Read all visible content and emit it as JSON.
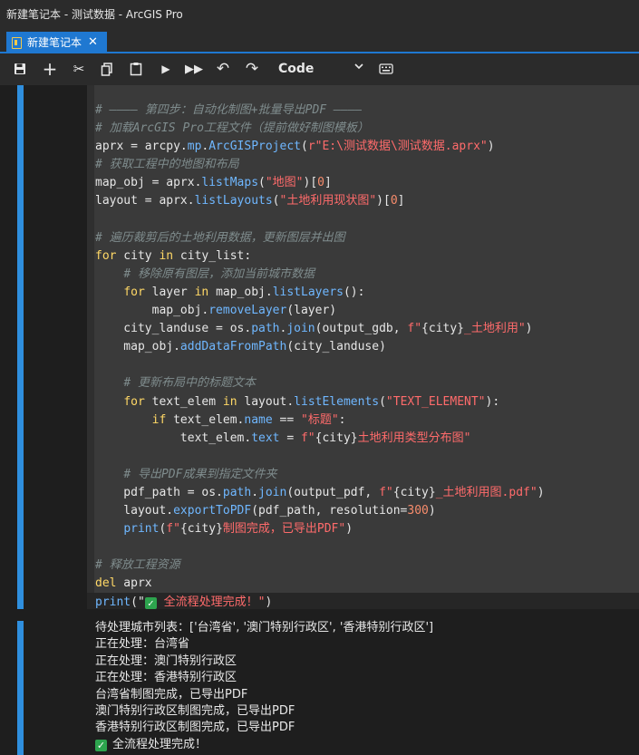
{
  "window": {
    "title": "新建笔记本 - 测试数据 - ArcGIS Pro"
  },
  "tab": {
    "label": "新建笔记本",
    "close": "✕"
  },
  "toolbar": {
    "buttons": [
      {
        "name": "save-icon",
        "glyph": "💾"
      },
      {
        "name": "add-cell-icon",
        "glyph": "+"
      },
      {
        "name": "cut-icon",
        "glyph": "✂"
      },
      {
        "name": "copy-icon",
        "glyph": "⧉"
      },
      {
        "name": "paste-icon",
        "glyph": "📋"
      },
      {
        "name": "run-icon",
        "glyph": "▶"
      },
      {
        "name": "run-all-icon",
        "glyph": "⏩"
      },
      {
        "name": "undo-icon",
        "glyph": "↶"
      },
      {
        "name": "redo-icon",
        "glyph": "↷"
      }
    ],
    "cell_type": "Code",
    "keyboard_icon": "⌨"
  },
  "code_lines": [
    [
      {
        "t": "c",
        "v": "# ———— 第四步：自动化制图+批量导出PDF ————"
      }
    ],
    [
      {
        "t": "c",
        "v": "# 加载ArcGIS Pro工程文件（提前做好制图模板）"
      }
    ],
    [
      {
        "t": "n",
        "v": "aprx = arcpy."
      },
      {
        "t": "f",
        "v": "mp"
      },
      {
        "t": "n",
        "v": "."
      },
      {
        "t": "f",
        "v": "ArcGISProject"
      },
      {
        "t": "n",
        "v": "("
      },
      {
        "t": "s",
        "v": "r\"E:\\测试数据\\测试数据.aprx\""
      },
      {
        "t": "n",
        "v": ")"
      }
    ],
    [
      {
        "t": "c",
        "v": "# 获取工程中的地图和布局"
      }
    ],
    [
      {
        "t": "n",
        "v": "map_obj = aprx."
      },
      {
        "t": "f",
        "v": "listMaps"
      },
      {
        "t": "n",
        "v": "("
      },
      {
        "t": "s",
        "v": "\"地图\""
      },
      {
        "t": "n",
        "v": ")["
      },
      {
        "t": "num",
        "v": "0"
      },
      {
        "t": "n",
        "v": "]"
      }
    ],
    [
      {
        "t": "n",
        "v": "layout = aprx."
      },
      {
        "t": "f",
        "v": "listLayouts"
      },
      {
        "t": "n",
        "v": "("
      },
      {
        "t": "s",
        "v": "\"土地利用现状图\""
      },
      {
        "t": "n",
        "v": ")["
      },
      {
        "t": "num",
        "v": "0"
      },
      {
        "t": "n",
        "v": "]"
      }
    ],
    [],
    [
      {
        "t": "c",
        "v": "# 遍历裁剪后的土地利用数据，更新图层并出图"
      }
    ],
    [
      {
        "t": "k",
        "v": "for"
      },
      {
        "t": "n",
        "v": " city "
      },
      {
        "t": "k",
        "v": "in"
      },
      {
        "t": "n",
        "v": " city_list:"
      }
    ],
    [
      {
        "t": "n",
        "v": "    "
      },
      {
        "t": "c",
        "v": "# 移除原有图层，添加当前城市数据"
      }
    ],
    [
      {
        "t": "n",
        "v": "    "
      },
      {
        "t": "k",
        "v": "for"
      },
      {
        "t": "n",
        "v": " layer "
      },
      {
        "t": "k",
        "v": "in"
      },
      {
        "t": "n",
        "v": " map_obj."
      },
      {
        "t": "f",
        "v": "listLayers"
      },
      {
        "t": "n",
        "v": "():"
      }
    ],
    [
      {
        "t": "n",
        "v": "        map_obj."
      },
      {
        "t": "f",
        "v": "removeLayer"
      },
      {
        "t": "n",
        "v": "(layer)"
      }
    ],
    [
      {
        "t": "n",
        "v": "    city_landuse = os."
      },
      {
        "t": "f",
        "v": "path"
      },
      {
        "t": "n",
        "v": "."
      },
      {
        "t": "f",
        "v": "join"
      },
      {
        "t": "n",
        "v": "(output_gdb, "
      },
      {
        "t": "s",
        "v": "f\""
      },
      {
        "t": "n",
        "v": "{city}"
      },
      {
        "t": "s",
        "v": "_土地利用\""
      },
      {
        "t": "n",
        "v": ")"
      }
    ],
    [
      {
        "t": "n",
        "v": "    map_obj."
      },
      {
        "t": "f",
        "v": "addDataFromPath"
      },
      {
        "t": "n",
        "v": "(city_landuse)"
      }
    ],
    [],
    [
      {
        "t": "n",
        "v": "    "
      },
      {
        "t": "c",
        "v": "# 更新布局中的标题文本"
      }
    ],
    [
      {
        "t": "n",
        "v": "    "
      },
      {
        "t": "k",
        "v": "for"
      },
      {
        "t": "n",
        "v": " text_elem "
      },
      {
        "t": "k",
        "v": "in"
      },
      {
        "t": "n",
        "v": " layout."
      },
      {
        "t": "f",
        "v": "listElements"
      },
      {
        "t": "n",
        "v": "("
      },
      {
        "t": "s",
        "v": "\"TEXT_ELEMENT\""
      },
      {
        "t": "n",
        "v": "):"
      }
    ],
    [
      {
        "t": "n",
        "v": "        "
      },
      {
        "t": "k",
        "v": "if"
      },
      {
        "t": "n",
        "v": " text_elem."
      },
      {
        "t": "f",
        "v": "name"
      },
      {
        "t": "n",
        "v": " == "
      },
      {
        "t": "s",
        "v": "\"标题\""
      },
      {
        "t": "n",
        "v": ":"
      }
    ],
    [
      {
        "t": "n",
        "v": "            text_elem."
      },
      {
        "t": "f",
        "v": "text"
      },
      {
        "t": "n",
        "v": " = "
      },
      {
        "t": "s",
        "v": "f\""
      },
      {
        "t": "n",
        "v": "{city}"
      },
      {
        "t": "s",
        "v": "土地利用类型分布图\""
      }
    ],
    [],
    [
      {
        "t": "n",
        "v": "    "
      },
      {
        "t": "c",
        "v": "# 导出PDF成果到指定文件夹"
      }
    ],
    [
      {
        "t": "n",
        "v": "    pdf_path = os."
      },
      {
        "t": "f",
        "v": "path"
      },
      {
        "t": "n",
        "v": "."
      },
      {
        "t": "f",
        "v": "join"
      },
      {
        "t": "n",
        "v": "(output_pdf, "
      },
      {
        "t": "s",
        "v": "f\""
      },
      {
        "t": "n",
        "v": "{city}"
      },
      {
        "t": "s",
        "v": "_土地利用图.pdf\""
      },
      {
        "t": "n",
        "v": ")"
      }
    ],
    [
      {
        "t": "n",
        "v": "    layout."
      },
      {
        "t": "f",
        "v": "exportToPDF"
      },
      {
        "t": "n",
        "v": "(pdf_path, resolution="
      },
      {
        "t": "num",
        "v": "300"
      },
      {
        "t": "n",
        "v": ")"
      }
    ],
    [
      {
        "t": "n",
        "v": "    "
      },
      {
        "t": "f",
        "v": "print"
      },
      {
        "t": "n",
        "v": "("
      },
      {
        "t": "s",
        "v": "f\""
      },
      {
        "t": "n",
        "v": "{city}"
      },
      {
        "t": "s",
        "v": "制图完成，已导出PDF\""
      },
      {
        "t": "n",
        "v": ")"
      }
    ],
    [],
    [
      {
        "t": "c",
        "v": "# 释放工程资源"
      }
    ],
    [
      {
        "t": "k",
        "v": "del"
      },
      {
        "t": "n",
        "v": " aprx"
      }
    ],
    [
      {
        "t": "f",
        "v": "print"
      },
      {
        "t": "n",
        "v": "(\""
      },
      {
        "t": "chk",
        "v": "✓"
      },
      {
        "t": "s",
        "v": " 全流程处理完成！\""
      },
      {
        "t": "n",
        "v": ")"
      }
    ]
  ],
  "output_lines": [
    "待处理城市列表：['台湾省', '澳门特别行政区', '香港特别行政区']",
    "正在处理：台湾省",
    "正在处理：澳门特别行政区",
    "正在处理：香港特别行政区",
    "台湾省制图完成，已导出PDF",
    "澳门特别行政区制图完成，已导出PDF",
    "香港特别行政区制图完成，已导出PDF",
    "全流程处理完成！"
  ],
  "output_check": "✓",
  "colors": {
    "accent": "#1f78d1",
    "cell_bar": "#2f8fde"
  }
}
